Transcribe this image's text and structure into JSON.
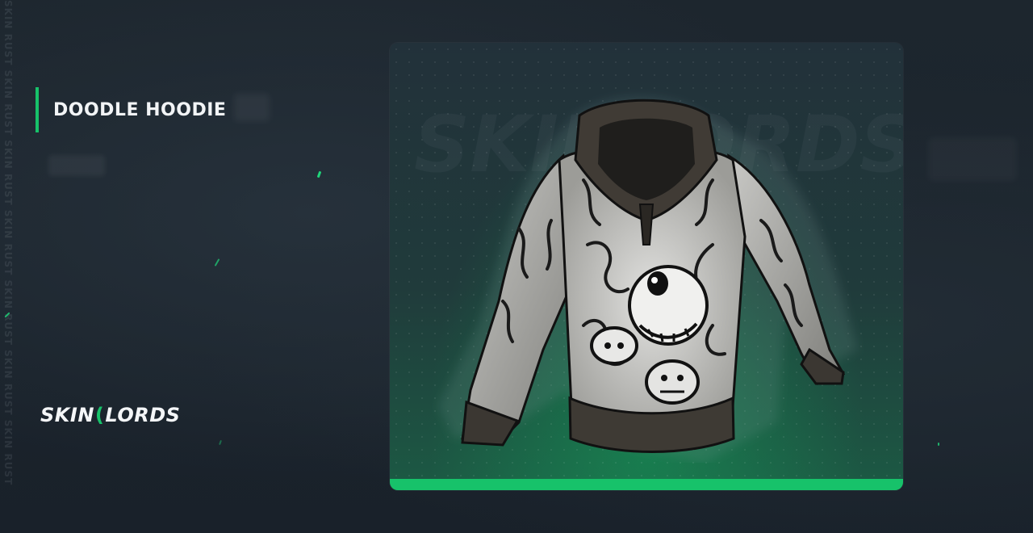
{
  "page": {
    "item_name": "DOODLE HOODIE",
    "side_watermark": "SKIN RUST SKIN RUST SKIN RUST SKIN RUST SKIN RUST SKIN RUST SKIN RUST",
    "card_watermark": "SKINLORDS"
  },
  "brand": {
    "name_left": "SKIN",
    "name_right": "LORDS"
  },
  "colors": {
    "accent": "#17c26a",
    "background": "#1b232b",
    "card_top": "#22313a",
    "card_bottom": "#1c5a44"
  },
  "icons": {
    "item": "hoodie-icon"
  }
}
